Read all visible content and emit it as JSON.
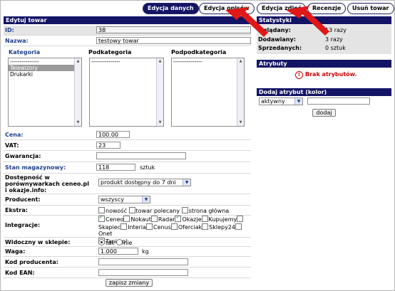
{
  "tabs": [
    {
      "label": "Edycja danych",
      "active": true
    },
    {
      "label": "Edycja opisów",
      "active": false
    },
    {
      "label": "Edycja zdjęć",
      "active": false
    },
    {
      "label": "Recenzje",
      "active": false
    },
    {
      "label": "Usuń towar",
      "active": false
    }
  ],
  "form": {
    "title": "Edytuj towar",
    "id_label": "ID:",
    "id_value": "38",
    "name_label": "Nazwa:",
    "name_value": "testowy towar",
    "cat_headers": [
      "Kategoria",
      "Podkategoria",
      "Podpodkategoria"
    ],
    "categories": [
      "---------------",
      "Telewizory",
      "Drukarki"
    ],
    "selected_category": "Telewizory",
    "subcategories": [
      "---------------"
    ],
    "subsubcategories": [
      "---------------"
    ],
    "price_label": "Cena:",
    "price_value": "100.00",
    "vat_label": "VAT:",
    "vat_value": "23",
    "warranty_label": "Gwarancja:",
    "warranty_value": "",
    "stock_label": "Stan magazynowy:",
    "stock_value": "118",
    "stock_unit": "sztuk",
    "availability_label": "Dostępność w porównywarkach ceneo.pl i okazje.info:",
    "availability_value": "produkt dostępny do 7 dni",
    "producer_label": "Producent:",
    "producer_value": "wszyscy",
    "extras_label": "Ekstra:",
    "extras": [
      {
        "label": "nowość",
        "checked": false
      },
      {
        "label": "towar polecany",
        "checked": false
      },
      {
        "label": "strona główna",
        "checked": false
      }
    ],
    "integrations_label": "Integracje:",
    "integrations": [
      {
        "label": "Ceneo",
        "checked": true
      },
      {
        "label": "Nokaut",
        "checked": false
      },
      {
        "label": "Radar",
        "checked": false
      },
      {
        "label": "Okazje",
        "checked": true
      },
      {
        "label": "Kupujemy",
        "checked": false
      },
      {
        "label": "Skapiec",
        "checked": false
      },
      {
        "label": "Interia",
        "checked": false
      },
      {
        "label": "Cenus",
        "checked": false
      },
      {
        "label": "Oferciak",
        "checked": false
      },
      {
        "label": "Sklepy24",
        "checked": false
      },
      {
        "label": "Onet",
        "checked": false
      },
      {
        "label": "Tanio.pl",
        "checked": false
      }
    ],
    "visible_label": "Widoczny w sklepie:",
    "visible_yes": "tak",
    "visible_no": "nie",
    "weight_label": "Waga:",
    "weight_value": "1.000",
    "weight_unit": "kg",
    "producer_code_label": "Kod producenta:",
    "producer_code_value": "",
    "ean_label": "Kod EAN:",
    "ean_value": "",
    "save_button": "zapisz zmiany"
  },
  "stats": {
    "title": "Statystyki",
    "rows": [
      {
        "label": "Oglądany:",
        "value": "13 razy"
      },
      {
        "label": "Dodawiany:",
        "value": "3 razy"
      },
      {
        "label": "Sprzedanych:",
        "value": "0 sztuk"
      }
    ]
  },
  "attributes": {
    "title": "Atrybuty",
    "empty_message": "Brak atrybutów."
  },
  "add_attribute": {
    "title": "Dodaj atrybut (kolor)",
    "status_value": "aktywny",
    "input_value": "",
    "add_button": "dodaj"
  },
  "colors": {
    "header": "#141466",
    "label_blue": "#1f3f8f",
    "annotation_arrow": "#e01818",
    "error": "#cc0000"
  }
}
